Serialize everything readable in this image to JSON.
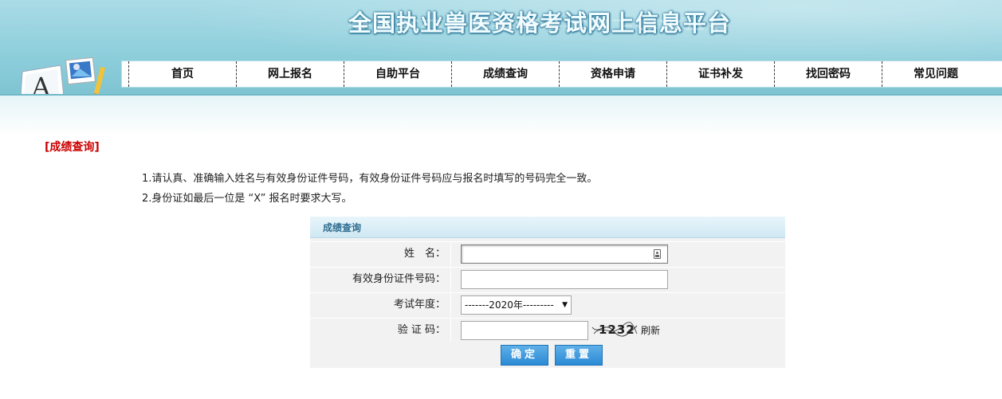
{
  "site": {
    "title": "全国执业兽医资格考试网上信息平台"
  },
  "nav": {
    "items": [
      {
        "label": "首页"
      },
      {
        "label": "网上报名"
      },
      {
        "label": "自助平台"
      },
      {
        "label": "成绩查询"
      },
      {
        "label": "资格申请"
      },
      {
        "label": "证书补发"
      },
      {
        "label": "找回密码"
      },
      {
        "label": "常见问题"
      }
    ]
  },
  "page": {
    "section_label": "[成绩查询]",
    "notes": [
      "1.请认真、准确输入姓名与有效身份证件号码，有效身份证件号码应与报名时填写的号码完全一致。",
      "2.身份证如最后一位是 “X” 报名时要求大写。"
    ]
  },
  "form": {
    "title": "成绩查询",
    "name_label": "姓　名：",
    "name_value": "",
    "id_label": "有效身份证件号码：",
    "id_value": "",
    "year_label": "考试年度：",
    "year_selected": "-------2020年---------",
    "captcha_label": "验 证 码：",
    "captcha_value": "",
    "captcha_text": "1232",
    "refresh_label": "刷新",
    "submit_label": "确定",
    "reset_label": "重置"
  },
  "colors": {
    "header_bg": "#8fcfdc",
    "section_label": "#cc0000",
    "button_bg": "#2b8ad4",
    "panel_bg": "#f2f2f2"
  }
}
